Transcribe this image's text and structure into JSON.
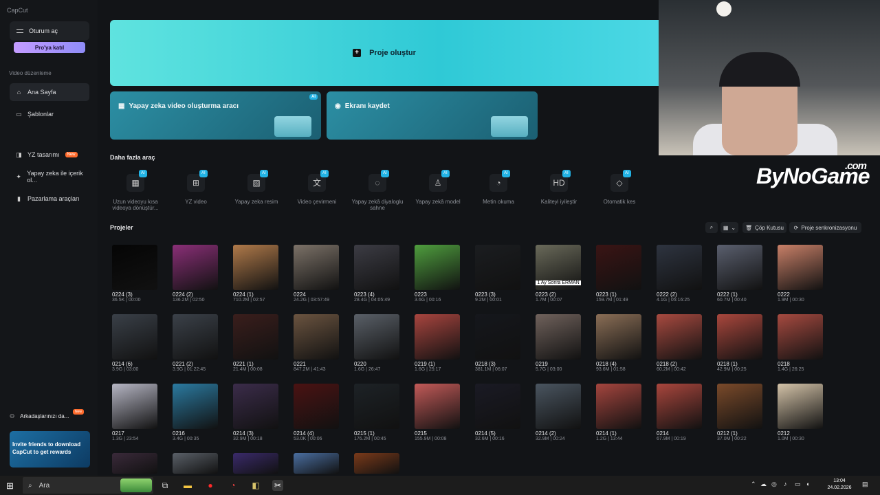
{
  "sidebar": {
    "logo": "CapCut",
    "login_label": "Oturum aç",
    "pro_label": "Pro'ya katıl",
    "section_label": "Video düzenleme",
    "nav": [
      {
        "label": "Ana Sayfa",
        "icon": "home-icon"
      },
      {
        "label": "Şablonlar",
        "icon": "template-icon"
      },
      {
        "label": "YZ tasarımı",
        "icon": "ai-design-icon",
        "badge": "New"
      },
      {
        "label": "Yapay zeka ile içerik ol...",
        "icon": "sparkle-icon"
      },
      {
        "label": "Pazarlama araçları",
        "icon": "marketing-icon"
      }
    ],
    "invite_label": "Arkadaşlarınızı da...",
    "invite_badge": "New",
    "promo_text": "Invite friends to download CapCut to get rewards"
  },
  "hero": {
    "label": "Proje oluştur"
  },
  "cards": [
    {
      "label": "Yapay zeka video oluşturma aracı",
      "badge": "AI"
    },
    {
      "label": "Ekranı kaydet"
    }
  ],
  "more_tools": {
    "title": "Daha fazla araç",
    "items": [
      {
        "label": "Uzun videoyu kısa videoya dönüştür...",
        "badge": "AI",
        "icon": "film-icon"
      },
      {
        "label": "YZ video",
        "badge": "AI",
        "icon": "video-plus-icon"
      },
      {
        "label": "Yapay zeka resim",
        "badge": "AI",
        "icon": "image-icon"
      },
      {
        "label": "Video çevirmeni",
        "badge": "AI",
        "icon": "translate-icon"
      },
      {
        "label": "Yapay zekâ diyaloglu sahne",
        "badge": "AI",
        "icon": "dialog-icon"
      },
      {
        "label": "Yapay zekâ model",
        "badge": "AI",
        "icon": "shirt-icon"
      },
      {
        "label": "Metin okuma",
        "badge": "AI",
        "icon": "speech-icon"
      },
      {
        "label": "Kaliteyi iyileştir",
        "badge": "AI",
        "icon": "hd-icon"
      },
      {
        "label": "Otomatik kes",
        "badge": "AI",
        "icon": "eraser-icon"
      }
    ]
  },
  "projects": {
    "title": "Projeler",
    "trash_label": "Çöp Kutusu",
    "sync_label": "Proje senkronizasyonu",
    "items": [
      {
        "name": "0224 (3)",
        "meta": "36.5K | 00:00",
        "color": "#050505"
      },
      {
        "name": "0224 (2)",
        "meta": "136.2M | 02:50",
        "color": "#8a2f77"
      },
      {
        "name": "0224 (1)",
        "meta": "710.2M | 02:57",
        "color": "#b07a4a"
      },
      {
        "name": "0224",
        "meta": "24.2G | 03:57:49",
        "color": "#7c7268"
      },
      {
        "name": "0223 (4)",
        "meta": "28.4G | 04:05:49",
        "color": "#3c3c44"
      },
      {
        "name": "0223",
        "meta": "3.6G | 00:16",
        "color": "#4f9e3e"
      },
      {
        "name": "0223 (3)",
        "meta": "9.2M | 00:01",
        "color": "#1b1d20"
      },
      {
        "name": "0223 (2)",
        "meta": "1.7M | 00:07",
        "color": "#6a6a5a",
        "caption": "1 Ay Sonra ERMAN"
      },
      {
        "name": "0223 (1)",
        "meta": "159.7M | 01:49",
        "color": "#3a1414"
      },
      {
        "name": "0222 (2)",
        "meta": "4.1G | 05:16:25",
        "color": "#2e3440"
      },
      {
        "name": "0222 (1)",
        "meta": "60.7M | 00:40",
        "color": "#5a5f6e"
      },
      {
        "name": "0222",
        "meta": "1.9M | 00:30",
        "color": "#c98068"
      },
      {
        "name": "0214 (6)",
        "meta": "3.9G | 03:00",
        "color": "#3a4048"
      },
      {
        "name": "0221 (2)",
        "meta": "3.9G | 01:22:45",
        "color": "#3b4149"
      },
      {
        "name": "0221 (1)",
        "meta": "21.4M | 00:08",
        "color": "#3a1e1c"
      },
      {
        "name": "0221",
        "meta": "847.2M | 41:43",
        "color": "#6b5440"
      },
      {
        "name": "0220",
        "meta": "1.6G | 26:47",
        "color": "#5a6068"
      },
      {
        "name": "0219 (1)",
        "meta": "1.6G | 25:17",
        "color": "#a8453f"
      },
      {
        "name": "0218 (3)",
        "meta": "381.1M | 06:07",
        "color": "#15171c"
      },
      {
        "name": "0219",
        "meta": "5.7G | 03:00",
        "color": "#70625c"
      },
      {
        "name": "0218 (4)",
        "meta": "93.6M | 01:58",
        "color": "#8a6e56"
      },
      {
        "name": "0218 (2)",
        "meta": "60.2M | 00:42",
        "color": "#a84a40"
      },
      {
        "name": "0218 (1)",
        "meta": "42.9M | 00:25",
        "color": "#a9473d"
      },
      {
        "name": "0218",
        "meta": "1.4G | 26:25",
        "color": "#a64a40"
      },
      {
        "name": "0217",
        "meta": "1.3G | 23:54",
        "color": "#b6b6c4"
      },
      {
        "name": "0216",
        "meta": "3.4G | 00:35",
        "color": "#2b7aa0"
      },
      {
        "name": "0214 (3)",
        "meta": "32.9M | 00:18",
        "color": "#3b2c4a"
      },
      {
        "name": "0214 (4)",
        "meta": "53.0K | 00:06",
        "color": "#4a1212"
      },
      {
        "name": "0215 (1)",
        "meta": "176.2M | 00:45",
        "color": "#1d2226"
      },
      {
        "name": "0215",
        "meta": "155.9M | 00:08",
        "color": "#c25a58"
      },
      {
        "name": "0214 (5)",
        "meta": "32.6M | 00:16",
        "color": "#1a1a24"
      },
      {
        "name": "0214 (2)",
        "meta": "32.9M | 00:24",
        "color": "#4a5560"
      },
      {
        "name": "0214 (1)",
        "meta": "1.2G | 13:44",
        "color": "#a4453e"
      },
      {
        "name": "0214",
        "meta": "67.9M | 00:19",
        "color": "#a9463d"
      },
      {
        "name": "0212 (1)",
        "meta": "37.0M | 00:22",
        "color": "#7a4a2a"
      },
      {
        "name": "0212",
        "meta": "1.0M | 00:30",
        "color": "#d4c3a8"
      },
      {
        "name": "",
        "meta": "",
        "color": "#3a2a3a"
      },
      {
        "name": "",
        "meta": "",
        "color": "#5a6068"
      },
      {
        "name": "",
        "meta": "",
        "color": "#3a2a6a"
      },
      {
        "name": "",
        "meta": "",
        "color": "#4a6ea0"
      },
      {
        "name": "",
        "meta": "",
        "color": "#7a3a1a"
      }
    ]
  },
  "overlay": {
    "brand": "ByNoGame",
    "brand_suffix": ".com"
  },
  "taskbar": {
    "search_placeholder": "Ara",
    "time": "13:04",
    "date": "24.02.2026"
  }
}
